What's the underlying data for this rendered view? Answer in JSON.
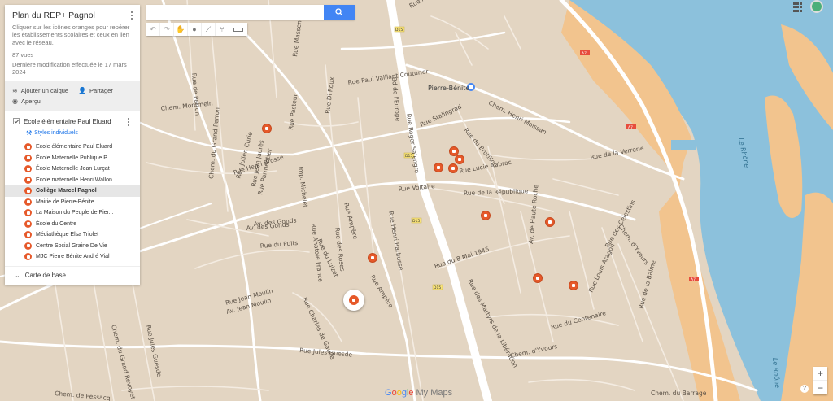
{
  "panel": {
    "title": "Plan du REP+ Pagnol",
    "description": "Cliquer sur les icônes oranges pour repérer les établissements scolaires et ceux en lien avec le réseau.",
    "views": "87 vues",
    "last_modified": "Dernière modification effectuée le 17 mars 2024",
    "actions": {
      "add_layer": "Ajouter un calque",
      "share": "Partager",
      "preview": "Aperçu"
    },
    "layer": {
      "name": "Ecole élémentaire Paul Eluard",
      "styles_link": "Styles individuels",
      "places": [
        {
          "label": "Ecole élémentaire Paul Eluard",
          "icon": "school-icon"
        },
        {
          "label": "École Maternelle Publique P...",
          "icon": "school-icon"
        },
        {
          "label": "École Maternelle Jean Lurçat",
          "icon": "school-icon"
        },
        {
          "label": "Ecole maternelle Henri Wallon",
          "icon": "school-icon"
        },
        {
          "label": "Collège Marcel Pagnol",
          "icon": "graduation-cap-icon",
          "selected": true
        },
        {
          "label": "Mairie de Pierre-Bénite",
          "icon": "city-hall-icon"
        },
        {
          "label": "La Maison du Peuple de Pier...",
          "icon": "building-icon"
        },
        {
          "label": "École du Centre",
          "icon": "school-icon"
        },
        {
          "label": "Médiathèque Elsa Triolet",
          "icon": "book-icon"
        },
        {
          "label": "Centre Social Graine De Vie",
          "icon": "building-icon"
        },
        {
          "label": "MJC Pierre Bénite André Vial",
          "icon": "building-icon"
        }
      ]
    },
    "base_map": "Carte de base"
  },
  "search": {
    "placeholder": ""
  },
  "map": {
    "streets": [
      "Rue Paul Vaillant Couturier",
      "Chem. Henri Moissan",
      "Rue Stalingrad",
      "Rue du Brotillon",
      "Rue Lucie Aubrac",
      "Rue Voltaire",
      "Rue de la République",
      "Rue Henri Brosse",
      "Rue Ampère",
      "Rue Henri Barbusse",
      "Rue du 8 Mai 1945",
      "Rue des Martyrs de la Libération",
      "Chem. du Grand Perron",
      "Rue Jean Jaurès",
      "Av. Jean Moulin",
      "Rue Charles de Gaulle",
      "Rue Jules Guesde",
      "Chem. d'Yvours",
      "Rue du Centenaire",
      "Av. de Haute Roche",
      "Rue Louis Aragon",
      "Chem. du Barrage",
      "Bd de l'Europe",
      "Chem. Montmein",
      "Rue de Perron",
      "Av. des Gonds",
      "Rue du Puits",
      "Rue Roger Salengro",
      "Rue de la Verrerie",
      "Rue Pasteur",
      "Rue Massenet",
      "Rue Di Roux",
      "Rue Julien Curie",
      "Rue Parmentier",
      "Rue des Roses",
      "Rue Anatole France",
      "Rue Jules Guesde",
      "Chem. du Grand Revoyet",
      "Chem. de Pessacq",
      "Chem. d'Yvours",
      "Rue Jean Moulin",
      "Rue de la Balme",
      "Rue Aulagne",
      "Imp. Michelet",
      "Av. des Gonds",
      "Rue des Célestins",
      "Rue du Luizet",
      "Rue Ampère"
    ],
    "river_name": "Le Rhône",
    "station": "Pierre-Bénite",
    "road_badges": [
      "D15",
      "D15",
      "D15",
      "A7",
      "A7",
      "A7",
      "D15"
    ]
  },
  "brand": {
    "google": "Google",
    "my_maps": "My Maps"
  },
  "zoom": {
    "in": "+",
    "out": "−"
  },
  "colors": {
    "pin": "#e6592a",
    "water": "#8cc1dc",
    "land": "#e3d5c2",
    "highway": "#f2c48e",
    "accent": "#4285f4"
  }
}
